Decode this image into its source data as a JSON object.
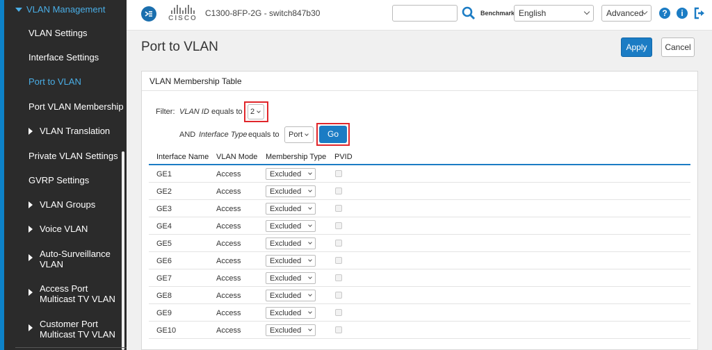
{
  "sidebar": {
    "group_label": "VLAN Management",
    "items": [
      {
        "label": "VLAN Settings"
      },
      {
        "label": "Interface Settings"
      },
      {
        "label": "Port to VLAN"
      },
      {
        "label": "Port VLAN Membership"
      },
      {
        "label": "VLAN Translation"
      },
      {
        "label": "Private VLAN Settings"
      },
      {
        "label": "GVRP Settings"
      },
      {
        "label": "VLAN Groups"
      },
      {
        "label": "Voice VLAN"
      },
      {
        "label": "Auto-Surveillance VLAN"
      },
      {
        "label": "Access Port Multicast TV VLAN"
      },
      {
        "label": "Customer Port Multicast TV VLAN"
      }
    ]
  },
  "header": {
    "logo_text": "CISCO",
    "device_name": "C1300-8FP-2G - switch847b30",
    "search_value": "",
    "benchmark_label": "Benchmark",
    "language": "English",
    "mode": "Advanced",
    "help_icon": "question-icon",
    "info_icon": "info-icon",
    "logout_icon": "logout-icon"
  },
  "page": {
    "title": "Port to VLAN",
    "apply_label": "Apply",
    "cancel_label": "Cancel"
  },
  "table_panel": {
    "title": "VLAN Membership Table",
    "filter": {
      "label": "Filter:",
      "field1": "VLAN ID",
      "equals1": "equals to",
      "vlan_id_value": "2",
      "and_label": "AND",
      "field2": "Interface Type",
      "equals2": "equals to",
      "interface_type_value": "Port",
      "go_label": "Go"
    },
    "columns": [
      "Interface Name",
      "VLAN Mode",
      "Membership Type",
      "PVID"
    ],
    "rows": [
      {
        "interface": "GE1",
        "mode": "Access",
        "membership": "Excluded",
        "pvid": false
      },
      {
        "interface": "GE2",
        "mode": "Access",
        "membership": "Excluded",
        "pvid": false
      },
      {
        "interface": "GE3",
        "mode": "Access",
        "membership": "Excluded",
        "pvid": false
      },
      {
        "interface": "GE4",
        "mode": "Access",
        "membership": "Excluded",
        "pvid": false
      },
      {
        "interface": "GE5",
        "mode": "Access",
        "membership": "Excluded",
        "pvid": false
      },
      {
        "interface": "GE6",
        "mode": "Access",
        "membership": "Excluded",
        "pvid": false
      },
      {
        "interface": "GE7",
        "mode": "Access",
        "membership": "Excluded",
        "pvid": false
      },
      {
        "interface": "GE8",
        "mode": "Access",
        "membership": "Excluded",
        "pvid": false
      },
      {
        "interface": "GE9",
        "mode": "Access",
        "membership": "Excluded",
        "pvid": false
      },
      {
        "interface": "GE10",
        "mode": "Access",
        "membership": "Excluded",
        "pvid": false
      }
    ]
  },
  "colors": {
    "accent": "#1b7cc4",
    "sidebar_bg": "#2b2b2b",
    "active_link": "#4aaee6",
    "highlight_box": "#e0262b"
  }
}
